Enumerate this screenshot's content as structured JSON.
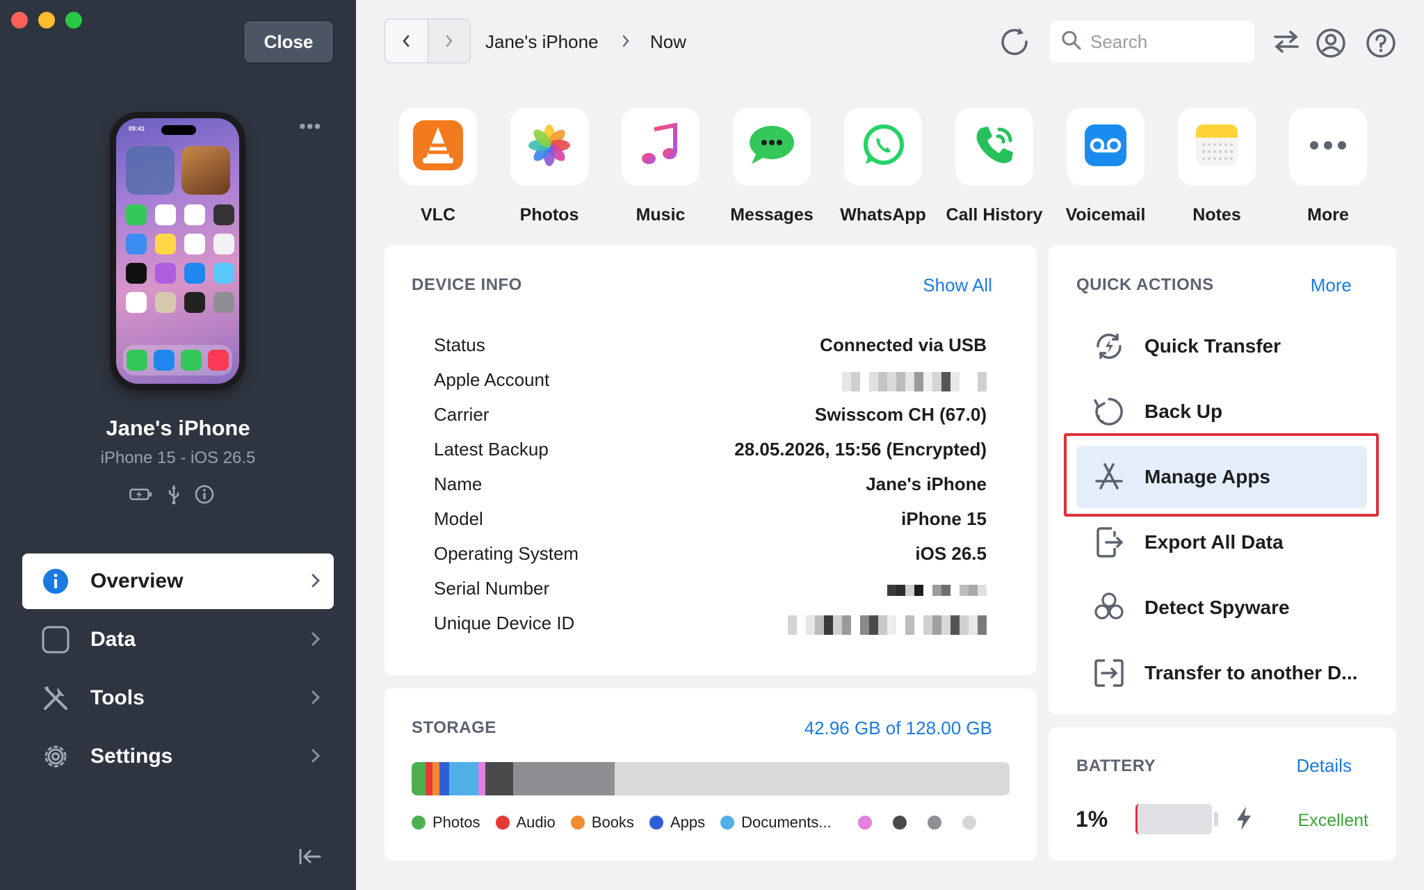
{
  "window": {
    "close_label": "Close"
  },
  "sidebar": {
    "device_name": "Jane's iPhone",
    "device_subtitle": "iPhone 15 - iOS 26.5",
    "nav": [
      {
        "label": "Overview",
        "icon": "info-icon"
      },
      {
        "label": "Data",
        "icon": "square-icon"
      },
      {
        "label": "Tools",
        "icon": "tools-icon"
      },
      {
        "label": "Settings",
        "icon": "gear-icon"
      }
    ],
    "phone_time": "09:41"
  },
  "toolbar": {
    "breadcrumb_device": "Jane's iPhone",
    "breadcrumb_current": "Now",
    "search_placeholder": "Search"
  },
  "apps": [
    {
      "label": "VLC",
      "icon": "vlc-icon"
    },
    {
      "label": "Photos",
      "icon": "photos-icon"
    },
    {
      "label": "Music",
      "icon": "music-icon"
    },
    {
      "label": "Messages",
      "icon": "messages-icon"
    },
    {
      "label": "WhatsApp",
      "icon": "whatsapp-icon"
    },
    {
      "label": "Call History",
      "icon": "call-history-icon"
    },
    {
      "label": "Voicemail",
      "icon": "voicemail-icon"
    },
    {
      "label": "Notes",
      "icon": "notes-icon"
    },
    {
      "label": "More",
      "icon": "more-icon"
    }
  ],
  "device_info": {
    "title": "DEVICE INFO",
    "link": "Show All",
    "rows": [
      {
        "key": "Status",
        "value": "Connected via USB"
      },
      {
        "key": "Apple Account",
        "value": ""
      },
      {
        "key": "Carrier",
        "value": "Swisscom CH (67.0)"
      },
      {
        "key": "Latest Backup",
        "value": "28.05.2026, 15:56 (Encrypted)"
      },
      {
        "key": "Name",
        "value": "Jane's iPhone"
      },
      {
        "key": "Model",
        "value": "iPhone 15"
      },
      {
        "key": "Operating System",
        "value": "iOS 26.5"
      },
      {
        "key": "Serial Number",
        "value": ""
      },
      {
        "key": "Unique Device ID",
        "value": ""
      }
    ]
  },
  "quick_actions": {
    "title": "QUICK ACTIONS",
    "link": "More",
    "items": [
      {
        "label": "Quick Transfer",
        "icon": "quick-transfer-icon"
      },
      {
        "label": "Back Up",
        "icon": "backup-icon"
      },
      {
        "label": "Manage Apps",
        "icon": "app-store-icon"
      },
      {
        "label": "Export All Data",
        "icon": "export-icon"
      },
      {
        "label": "Detect Spyware",
        "icon": "biohazard-icon"
      },
      {
        "label": "Transfer to another D...",
        "icon": "transfer-device-icon"
      }
    ]
  },
  "storage": {
    "title": "STORAGE",
    "summary": "42.96 GB of 128.00 GB",
    "used_fraction": 0.34,
    "legend": [
      {
        "label": "Photos",
        "color": "#4cb050"
      },
      {
        "label": "Audio",
        "color": "#e53935"
      },
      {
        "label": "Books",
        "color": "#f28a30"
      },
      {
        "label": "Apps",
        "color": "#2f5fd8"
      },
      {
        "label": "Documents...",
        "color": "#4fb0e8"
      }
    ],
    "extra_dots": [
      "#e47fe0",
      "#4a4a4c",
      "#8e8e93",
      "#d6d6d8"
    ]
  },
  "battery": {
    "title": "BATTERY",
    "link": "Details",
    "percent": "1%",
    "level": 0.01,
    "health": "Excellent"
  }
}
